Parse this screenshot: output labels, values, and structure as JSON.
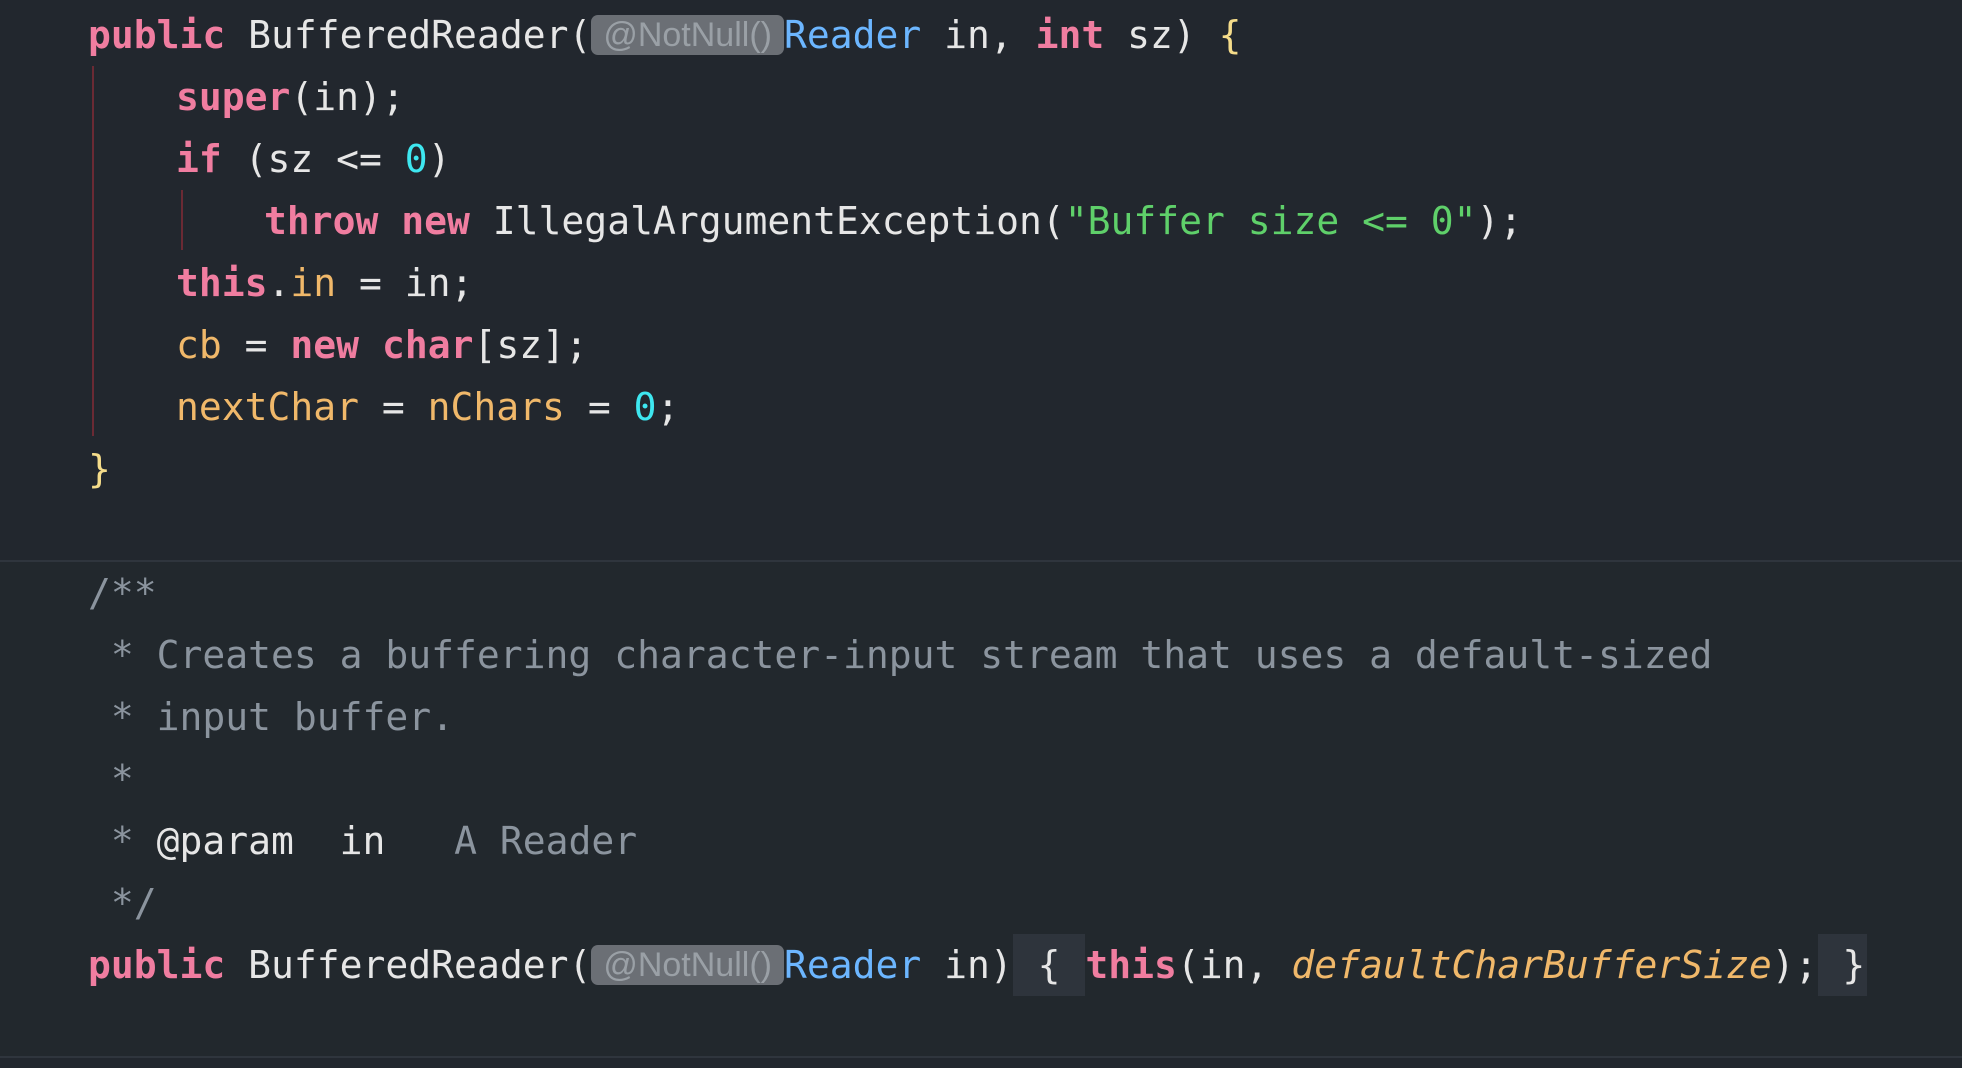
{
  "code": {
    "l1": {
      "kw_public": "public",
      "ctor_name": " BufferedReader(",
      "annotation": "@NotNull()",
      "type_reader": "Reader",
      "param_in": " in, ",
      "kw_int": "int",
      "param_sz": " sz) ",
      "open_brace": "{"
    },
    "l2": {
      "kw_super": "super",
      "rest": "(in);"
    },
    "l3": {
      "kw_if": "if",
      "cond": " (sz <= ",
      "zero": "0",
      "close": ")"
    },
    "l4": {
      "kw_throw": "throw",
      "kw_new": "new",
      "exception": " IllegalArgumentException(",
      "message": "\"Buffer size <= 0\"",
      "end": ");"
    },
    "l5": {
      "kw_this": "this",
      "dot": ".",
      "field_in": "in",
      "rest": " = in;"
    },
    "l6": {
      "field_cb": "cb",
      "eq": " = ",
      "kw_new": "new",
      "kw_char": "char",
      "rest": "[sz];"
    },
    "l7": {
      "field_next": "nextChar",
      "eq1": " = ",
      "field_nchars": "nChars",
      "eq2": " = ",
      "zero": "0",
      "semi": ";"
    },
    "l8": {
      "close_brace": "}"
    },
    "javadoc": {
      "open": "/**",
      "line1": " * Creates a buffering character-input stream that uses a default-sized",
      "line2": " * input buffer.",
      "line3": " *",
      "line4_star": " * ",
      "line4_tag": "@param",
      "line4_name": "  in",
      "line4_desc": "   A Reader",
      "close": " */"
    },
    "l9": {
      "kw_public": "public",
      "ctor_name": " BufferedReader(",
      "annotation": "@NotNull()",
      "type_reader": "Reader",
      "param_in": " in)",
      "fold_open": " { ",
      "kw_this": "this",
      "args_open": "(in, ",
      "static_field": "defaultCharBufferSize",
      "args_close": ");",
      "fold_close": " }"
    }
  }
}
